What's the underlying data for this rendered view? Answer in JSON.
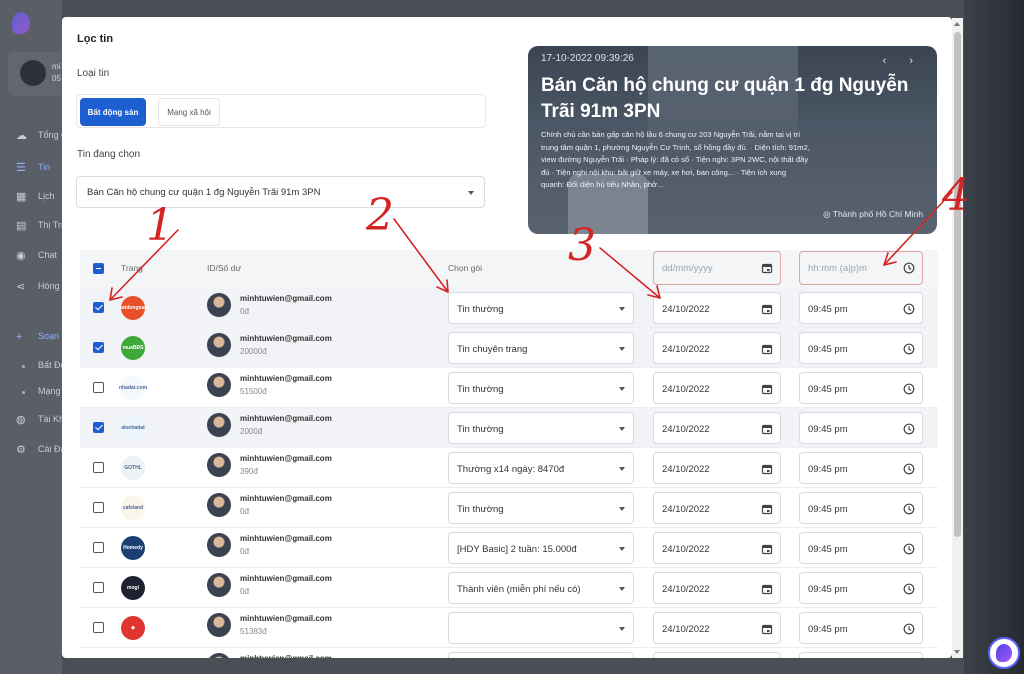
{
  "background": {
    "user": {
      "name": "mi",
      "sub": "05"
    },
    "menu": [
      {
        "icon": "cloud-icon",
        "label": "Tổng Q"
      },
      {
        "icon": "list-icon",
        "label": "Tin",
        "active": true
      },
      {
        "icon": "calendar-icon",
        "label": "Lịch"
      },
      {
        "icon": "chart-icon",
        "label": "Thị Trư"
      },
      {
        "icon": "chat-icon",
        "label": "Chat"
      },
      {
        "icon": "share-icon",
        "label": "Hóng"
      },
      {
        "icon": "plus-icon",
        "label": "Soạn T",
        "active": true
      },
      {
        "icon": "dot",
        "label": "Bất Độ"
      },
      {
        "icon": "dot",
        "label": "Mạng"
      },
      {
        "icon": "users-icon",
        "label": "Tài Kh"
      },
      {
        "icon": "gear-icon",
        "label": "Cài Đặ"
      }
    ]
  },
  "modal": {
    "title": "Lọc tin",
    "news_type_label": "Loại tin",
    "news_types": [
      "Bất động sản",
      "Mạng xã hội"
    ],
    "selected_news_label": "Tin đang chọn",
    "selected_news": "Bán Căn hộ chung cư quận 1 đg Nguyễn Trãi 91m 3PN",
    "preview": {
      "date": "17-10-2022 09:39:26",
      "title": "Bán Căn hộ chung cư quận 1 đg Nguyễn Trãi 91m 3PN",
      "description": "Chính chủ cần bán gấp căn hộ lầu 6 chung cư 203 Nguyễn Trãi, nằm tại vị trí trung tâm quận 1, phường Nguyễn Cư Trinh, sổ hồng đầy đủ. · Diện tích: 91m2, view đường Nguyễn Trãi · Pháp lý: đã có sổ · Tiện nghi: 3PN 2WC, nội thất đầy đủ · Tiện nghi nội khu: bãi giữ xe máy, xe hơi, ban công... · Tiện ích xung quanh: Đối diện hủ tiếu Nhân, phở...",
      "location": "Thành phố Hồ Chí Minh",
      "nav": "‹ ›"
    },
    "filters": {
      "date_placeholder": "dd/mm/yyyy",
      "time_placeholder": "hh:mm (a|p)m"
    },
    "columns": [
      "Trang",
      "ID/Số dư",
      "Chọn gói"
    ],
    "rows": [
      {
        "checked": true,
        "logo": {
          "text": "batdongsan",
          "bg": "#e8502b"
        },
        "email": "minhtuwien@gmail.com",
        "balance": "0đ",
        "package": "Tin thường",
        "date": "24/10/2022",
        "time": "09:45 pm",
        "highlight": true
      },
      {
        "checked": true,
        "logo": {
          "text": "muaBĐS",
          "bg": "#3fa83b"
        },
        "email": "minhtuwien@gmail.com",
        "balance": "20000đ",
        "package": "Tin chuyên trang",
        "date": "24/10/2022",
        "time": "09:45 pm",
        "highlight": true
      },
      {
        "checked": false,
        "logo": {
          "text": "nhadat.com",
          "bg": "#f4f7fb"
        },
        "email": "minhtuwien@gmail.com",
        "balance": "51500đ",
        "package": "Tin thường",
        "date": "24/10/2022",
        "time": "09:45 pm",
        "highlight": false
      },
      {
        "checked": true,
        "logo": {
          "text": "alonhadat",
          "bg": "#eaf6fb"
        },
        "email": "minhtuwien@gmail.com",
        "balance": "2000đ",
        "package": "Tin thường",
        "date": "24/10/2022",
        "time": "09:45 pm",
        "highlight": true
      },
      {
        "checked": false,
        "logo": {
          "text": "GOTHL",
          "bg": "#eef2f7"
        },
        "email": "minhtuwien@gmail.com",
        "balance": "390đ",
        "package": "Thường x14 ngày: 8470đ",
        "date": "24/10/2022",
        "time": "09:45 pm",
        "highlight": false
      },
      {
        "checked": false,
        "logo": {
          "text": "cafeland",
          "bg": "#fbf6ea"
        },
        "email": "minhtuwien@gmail.com",
        "balance": "0đ",
        "package": "Tin thường",
        "date": "24/10/2022",
        "time": "09:45 pm",
        "highlight": false
      },
      {
        "checked": false,
        "logo": {
          "text": "Homedy",
          "bg": "#1d3f74"
        },
        "email": "minhtuwien@gmail.com",
        "balance": "0đ",
        "package": "[HDY Basic] 2 tuần: 15.000đ",
        "date": "24/10/2022",
        "time": "09:45 pm",
        "highlight": false
      },
      {
        "checked": false,
        "logo": {
          "text": "mogi",
          "bg": "#1e2230"
        },
        "email": "minhtuwien@gmail.com",
        "balance": "0đ",
        "package": "Thành viên (miễn phí nếu có)",
        "date": "24/10/2022",
        "time": "09:45 pm",
        "highlight": false
      },
      {
        "checked": false,
        "logo": {
          "text": "◆",
          "bg": "#e0342f"
        },
        "email": "minhtuwien@gmail.com",
        "balance": "51383đ",
        "package": "",
        "date": "24/10/2022",
        "time": "09:45 pm",
        "highlight": false
      },
      {
        "checked": false,
        "logo": {
          "text": "",
          "bg": "#ffffff"
        },
        "email": "minhtuwien@gmail.com",
        "balance": "",
        "package": "",
        "date": "",
        "time": "",
        "highlight": false
      }
    ]
  },
  "annotations": [
    "1",
    "2",
    "3",
    "4"
  ],
  "colors": {
    "primary": "#1d5fd1",
    "annotation": "#d42525",
    "invalid_border": "#e2a3a3"
  }
}
